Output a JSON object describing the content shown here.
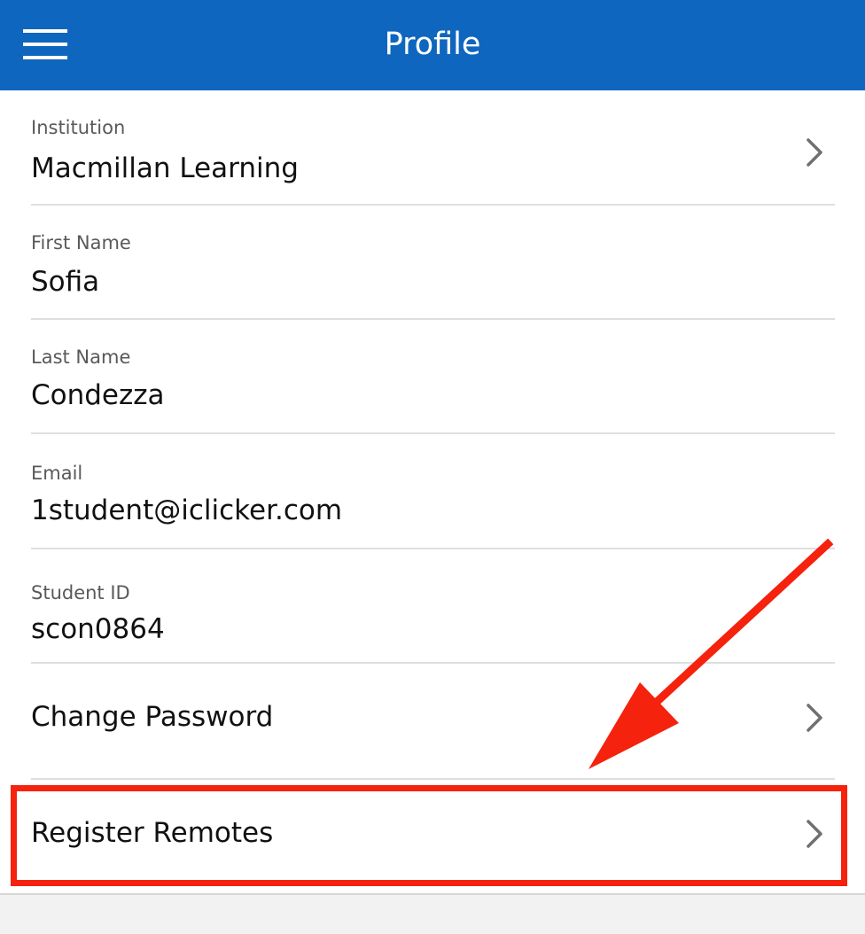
{
  "header": {
    "title": "Profile",
    "menu_icon": "hamburger-menu-icon",
    "background_color": "#0f66be"
  },
  "fields": [
    {
      "label": "Institution",
      "value": "Macmillan Learning"
    },
    {
      "label": "First Name",
      "value": "Sofia"
    },
    {
      "label": "Last Name",
      "value": "Condezza"
    },
    {
      "label": "Email",
      "value": "1student@iclicker.com"
    },
    {
      "label": "Student ID",
      "value": "scon0864"
    }
  ],
  "links": {
    "change_password": "Change Password",
    "register_remotes": "Register Remotes"
  },
  "icons": {
    "chevron": "chevron-right-icon"
  },
  "annotation": {
    "highlight_color": "#f5220d",
    "arrow_color": "#f5220d"
  }
}
